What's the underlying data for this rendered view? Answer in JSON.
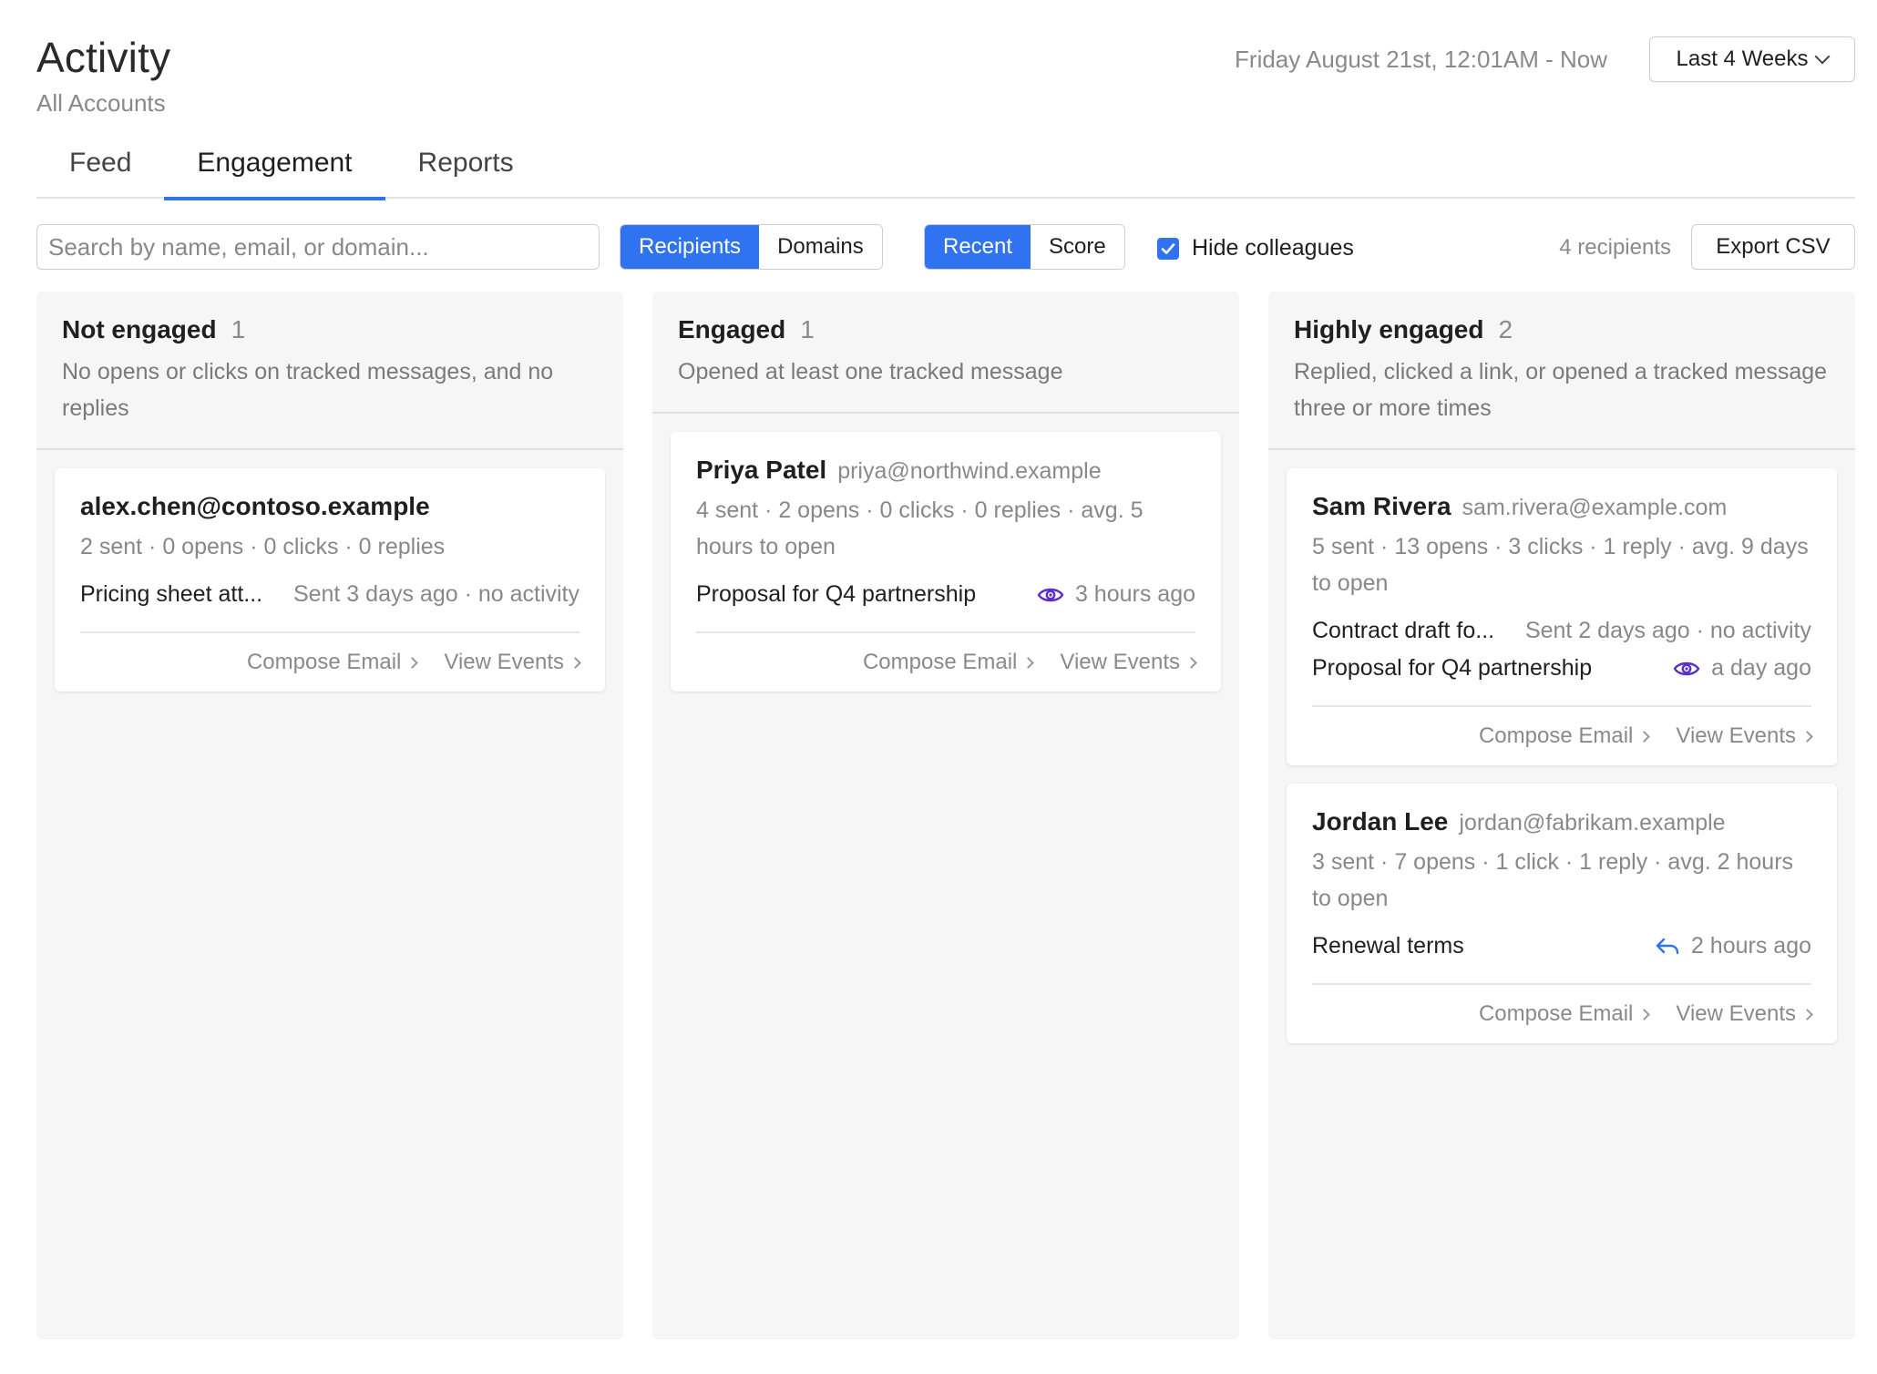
{
  "page": {
    "title": "Activity",
    "subtitle": "All Accounts"
  },
  "date_range": "Friday August 21st, 12:01AM - Now",
  "period": {
    "label": "Last 4 Weeks"
  },
  "tabs": [
    {
      "label": "Feed",
      "active": false
    },
    {
      "label": "Engagement",
      "active": true
    },
    {
      "label": "Reports",
      "active": false
    }
  ],
  "toolbar": {
    "search_placeholder": "Search by name, email, or domain...",
    "view_toggle": [
      "Recipients",
      "Domains"
    ],
    "view_selected": "Recipients",
    "sort_toggle": [
      "Recent",
      "Score"
    ],
    "sort_selected": "Recent",
    "hide_colleagues_label": "Hide colleagues",
    "hide_colleagues_checked": true,
    "recipient_count": "4 recipients",
    "export_label": "Export CSV"
  },
  "colors": {
    "accent": "#2f73f0",
    "open_icon": "#5b2fc9",
    "reply_icon": "#2f73f0"
  },
  "columns": [
    {
      "title": "Not engaged",
      "count": "1",
      "description": "No opens or clicks on tracked messages, and no replies",
      "cards": [
        {
          "name": "alex.chen@contoso.example",
          "email": "",
          "stats": "2 sent · 0 opens · 0 clicks · 0 replies",
          "messages": [
            {
              "subject": "Pricing sheet att...",
              "icon": "",
              "meta": "Sent 3 days ago · no activity"
            }
          ],
          "actions": [
            "Compose Email",
            "View Events"
          ]
        }
      ]
    },
    {
      "title": "Engaged",
      "count": "1",
      "description": "Opened at least one tracked message",
      "cards": [
        {
          "name": "Priya Patel",
          "email": "priya@northwind.example",
          "stats": "4 sent · 2 opens · 0 clicks · 0 replies · avg. 5 hours to open",
          "messages": [
            {
              "subject": "Proposal for Q4 partnership",
              "icon": "eye-icon",
              "meta": "3 hours ago"
            }
          ],
          "actions": [
            "Compose Email",
            "View Events"
          ]
        }
      ]
    },
    {
      "title": "Highly engaged",
      "count": "2",
      "description": "Replied, clicked a link, or opened a tracked message three or more times",
      "cards": [
        {
          "name": "Sam Rivera",
          "email": "sam.rivera@example.com",
          "stats": "5 sent · 13 opens · 3 clicks · 1 reply · avg. 9 days to open",
          "messages": [
            {
              "subject": "Contract draft fo...",
              "icon": "",
              "meta": "Sent 2 days ago · no activity"
            },
            {
              "subject": "Proposal for Q4 partnership",
              "icon": "eye-icon",
              "meta": "a day ago"
            }
          ],
          "actions": [
            "Compose Email",
            "View Events"
          ]
        },
        {
          "name": "Jordan Lee",
          "email": "jordan@fabrikam.example",
          "stats": "3 sent · 7 opens · 1 click · 1 reply · avg. 2 hours to open",
          "messages": [
            {
              "subject": "Renewal terms",
              "icon": "reply-icon",
              "meta": "2 hours ago"
            }
          ],
          "actions": [
            "Compose Email",
            "View Events"
          ]
        }
      ]
    }
  ]
}
